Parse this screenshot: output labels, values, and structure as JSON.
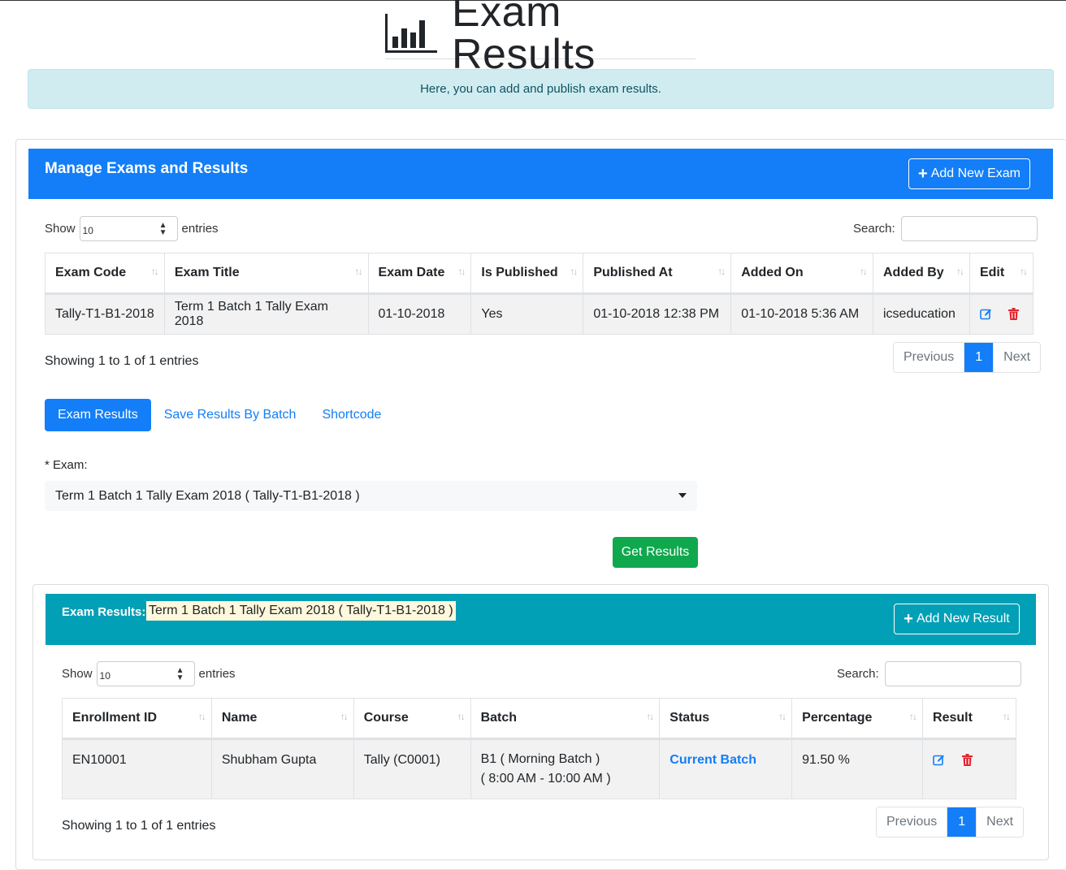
{
  "header": {
    "title": "Exam Results",
    "icon": "bar-chart-icon"
  },
  "info_alert": "Here, you can add and publish exam results.",
  "manage_card": {
    "title": "Manage Exams and Results",
    "add_button": "Add New Exam",
    "show_label": "Show",
    "entries_value": "10",
    "entries_label": "entries",
    "search_label": "Search:",
    "search_value": "",
    "columns": [
      "Exam Code",
      "Exam Title",
      "Exam Date",
      "Is Published",
      "Published At",
      "Added On",
      "Added By",
      "Edit"
    ],
    "rows": [
      {
        "exam_code": "Tally-T1-B1-2018",
        "exam_title": "Term 1 Batch 1 Tally Exam 2018",
        "exam_date": "01-10-2018",
        "is_published": "Yes",
        "published_at": "01-10-2018 12:38 PM",
        "added_on": "01-10-2018 5:36 AM",
        "added_by": "icseducation"
      }
    ],
    "info": "Showing 1 to 1 of 1 entries",
    "pagination": {
      "previous": "Previous",
      "page": "1",
      "next": "Next"
    }
  },
  "tabs": [
    {
      "label": "Exam Results",
      "active": true
    },
    {
      "label": "Save Results By Batch",
      "active": false
    },
    {
      "label": "Shortcode",
      "active": false
    }
  ],
  "exam_form": {
    "label": "* Exam:",
    "selected": "Term 1 Batch 1 Tally Exam 2018 ( Tally-T1-B1-2018 )",
    "submit": "Get Results"
  },
  "results_card": {
    "title_label": "Exam Results:",
    "title_value": "Term 1 Batch 1 Tally Exam 2018 ( Tally-T1-B1-2018 )",
    "add_button": "Add New Result",
    "show_label": "Show",
    "entries_value": "10",
    "entries_label": "entries",
    "search_label": "Search:",
    "search_value": "",
    "columns": [
      "Enrollment ID",
      "Name",
      "Course",
      "Batch",
      "Status",
      "Percentage",
      "Result"
    ],
    "rows": [
      {
        "enrollment_id": "EN10001",
        "name": "Shubham Gupta",
        "course": "Tally (C0001)",
        "batch_line1": "B1 ( Morning Batch )",
        "batch_line2": "( 8:00 AM - 10:00 AM )",
        "status": "Current Batch",
        "percentage": "91.50 %"
      }
    ],
    "info": "Showing 1 to 1 of 1 entries",
    "pagination": {
      "previous": "Previous",
      "page": "1",
      "next": "Next"
    }
  },
  "colors": {
    "primary": "#137ef8",
    "info_header": "#01a0b6",
    "success": "#0fa84d",
    "danger": "#e3262f",
    "alert_bg": "#d1ecf1"
  }
}
